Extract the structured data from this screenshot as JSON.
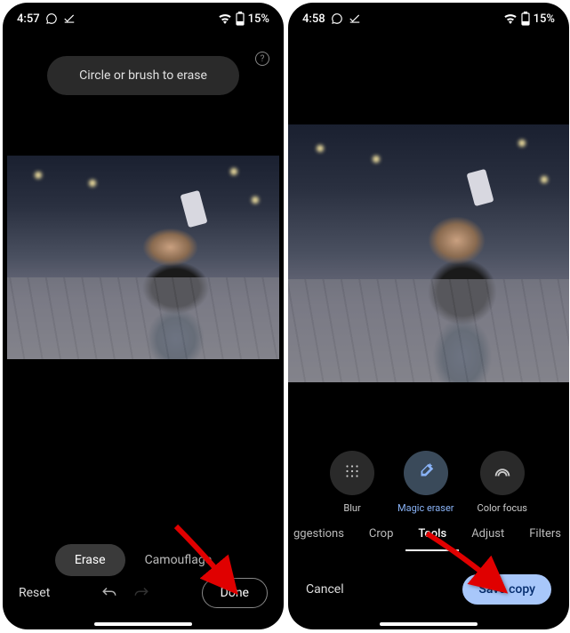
{
  "left": {
    "status": {
      "time": "4:57",
      "battery": "15%"
    },
    "tip": "Circle or brush to erase",
    "modes": {
      "erase": "Erase",
      "camouflage": "Camouflage"
    },
    "reset": "Reset",
    "done": "Done"
  },
  "right": {
    "status": {
      "time": "4:58",
      "battery": "15%"
    },
    "tools": {
      "blur": "Blur",
      "magic_eraser": "Magic eraser",
      "color_focus": "Color focus"
    },
    "categories": {
      "suggestions": "ggestions",
      "crop": "Crop",
      "tools": "Tools",
      "adjust": "Adjust",
      "filters": "Filters"
    },
    "cancel": "Cancel",
    "save": "Save copy"
  }
}
